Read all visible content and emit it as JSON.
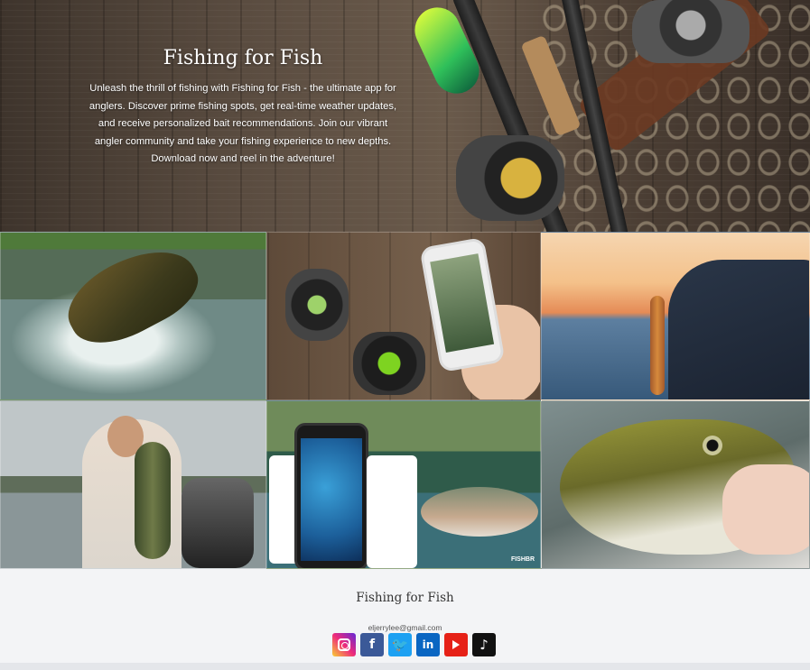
{
  "hero": {
    "title": "Fishing for Fish",
    "description": "Unleash the thrill of fishing with Fishing for Fish - the ultimate app for anglers. Discover prime fishing spots, get real-time weather updates, and receive personalized bait recommendations. Join our vibrant angler community and take your fishing experience to new depths. Download now and reel in the adventure!"
  },
  "gallery": {
    "tiles": [
      {
        "name": "bass-jumping-photo",
        "icon": "bass-jumping-image"
      },
      {
        "name": "reels-and-app-phone-photo",
        "icon": "phone-app-image"
      },
      {
        "name": "sunset-pike-catch-photo",
        "icon": "sunset-fishing-image"
      },
      {
        "name": "angler-with-bass-photo",
        "icon": "angler-image"
      },
      {
        "name": "app-screens-and-trout-photo",
        "icon": "app-screens-image",
        "brand_text": "FISHBR"
      },
      {
        "name": "walleye-closeup-photo",
        "icon": "walleye-image"
      }
    ]
  },
  "footer": {
    "title": "Fishing for Fish",
    "email": "eljerrylee@gmail.com",
    "socials": [
      {
        "name": "instagram",
        "icon": "instagram-icon",
        "color": "#ee2a7b"
      },
      {
        "name": "facebook",
        "icon": "facebook-icon",
        "glyph": "f",
        "color": "#3b5998"
      },
      {
        "name": "twitter",
        "icon": "twitter-icon",
        "glyph": "🐦",
        "color": "#1da1f2"
      },
      {
        "name": "linkedin",
        "icon": "linkedin-icon",
        "glyph": "in",
        "color": "#0a66c2"
      },
      {
        "name": "youtube",
        "icon": "youtube-icon",
        "color": "#e62117"
      },
      {
        "name": "tiktok",
        "icon": "tiktok-icon",
        "glyph": "♪",
        "color": "#111111"
      }
    ]
  }
}
